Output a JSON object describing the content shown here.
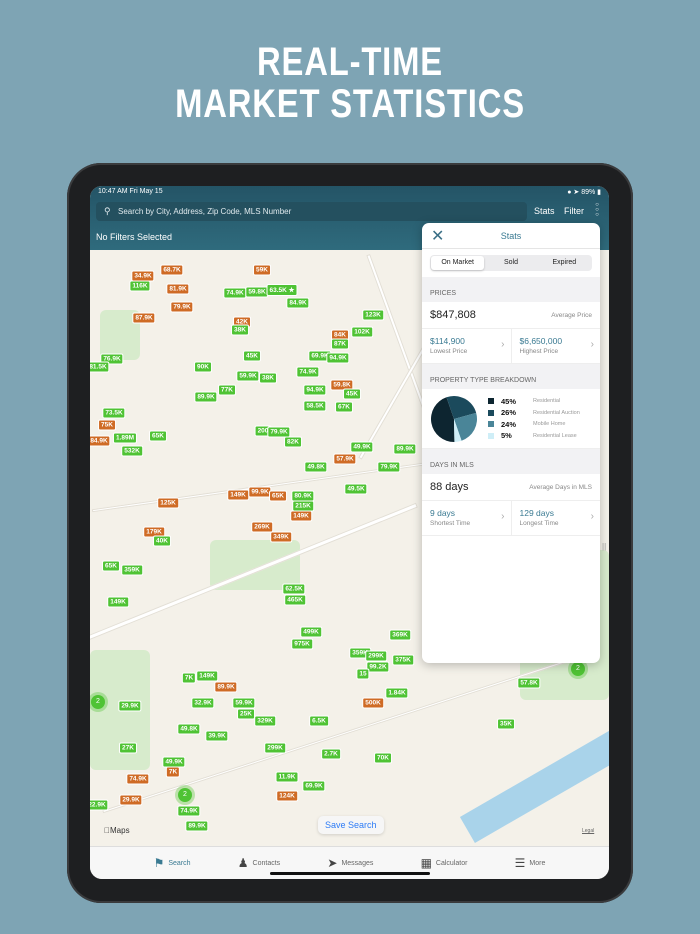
{
  "headline": {
    "line1": "REAL-TIME",
    "line2": "MARKET STATISTICS"
  },
  "status": {
    "time": "10:47 AM  Fri May 15",
    "battery": "89%"
  },
  "header": {
    "search_placeholder": "Search by City, Address, Zip Code, MLS Number",
    "stats_label": "Stats",
    "filter_label": "Filter",
    "filters_text": "No Filters Selected"
  },
  "map": {
    "attribution": "Maps",
    "legal": "Legal",
    "save_search": "Save Search",
    "markers": [
      {
        "p": "68.7K",
        "s": "o"
      },
      {
        "p": "34.9K",
        "s": "o"
      },
      {
        "p": "116K",
        "s": "g"
      },
      {
        "p": "81.9K",
        "s": "o"
      },
      {
        "p": "79.9K",
        "s": "o"
      },
      {
        "p": "87.9K",
        "s": "o"
      },
      {
        "p": "59K",
        "s": "o"
      },
      {
        "p": "74.9K",
        "s": "g"
      },
      {
        "p": "59.8K",
        "s": "g"
      },
      {
        "p": "63.5K ★",
        "s": "g"
      },
      {
        "p": "84.9K",
        "s": "g"
      },
      {
        "p": "42K",
        "s": "o"
      },
      {
        "p": "38K",
        "s": "g"
      },
      {
        "p": "123K",
        "s": "g"
      },
      {
        "p": "102K",
        "s": "g"
      },
      {
        "p": "84K",
        "s": "o"
      },
      {
        "p": "87K",
        "s": "g"
      },
      {
        "p": "45K",
        "s": "g"
      },
      {
        "p": "69.9K",
        "s": "g"
      },
      {
        "p": "94.9K",
        "s": "g"
      },
      {
        "p": "76.9K",
        "s": "g"
      },
      {
        "p": "81.5K",
        "s": "g"
      },
      {
        "p": "90K",
        "s": "g"
      },
      {
        "p": "59.9K",
        "s": "g"
      },
      {
        "p": "38K",
        "s": "g"
      },
      {
        "p": "74.9K",
        "s": "g"
      },
      {
        "p": "59.8K",
        "s": "o"
      },
      {
        "p": "94.9K",
        "s": "g"
      },
      {
        "p": "77K",
        "s": "g"
      },
      {
        "p": "89.9K",
        "s": "g"
      },
      {
        "p": "45K",
        "s": "g"
      },
      {
        "p": "58.5K",
        "s": "g"
      },
      {
        "p": "67K",
        "s": "g"
      },
      {
        "p": "73.5K",
        "s": "g"
      },
      {
        "p": "75K",
        "s": "o"
      },
      {
        "p": "84.9K",
        "s": "o"
      },
      {
        "p": "1.89M",
        "s": "g"
      },
      {
        "p": "65K",
        "s": "g"
      },
      {
        "p": "532K",
        "s": "g"
      },
      {
        "p": "200",
        "s": "g"
      },
      {
        "p": "79.9K",
        "s": "g"
      },
      {
        "p": "82K",
        "s": "g"
      },
      {
        "p": "49.9K",
        "s": "g"
      },
      {
        "p": "89.9K",
        "s": "g"
      },
      {
        "p": "57.9K",
        "s": "o"
      },
      {
        "p": "49.8K",
        "s": "g"
      },
      {
        "p": "79.9K",
        "s": "g"
      },
      {
        "p": "49.5K",
        "s": "g"
      },
      {
        "p": "149K",
        "s": "o"
      },
      {
        "p": "99.9K",
        "s": "o"
      },
      {
        "p": "65K",
        "s": "o"
      },
      {
        "p": "80.9K",
        "s": "g"
      },
      {
        "p": "215K",
        "s": "g"
      },
      {
        "p": "125K",
        "s": "o"
      },
      {
        "p": "149K",
        "s": "o"
      },
      {
        "p": "269K",
        "s": "o"
      },
      {
        "p": "349K",
        "s": "o"
      },
      {
        "p": "179K",
        "s": "o"
      },
      {
        "p": "40K",
        "s": "g"
      },
      {
        "p": "65K",
        "s": "g"
      },
      {
        "p": "359K",
        "s": "g"
      },
      {
        "p": "149K",
        "s": "g"
      },
      {
        "p": "62.5K",
        "s": "g"
      },
      {
        "p": "465K",
        "s": "g"
      },
      {
        "p": "499K",
        "s": "g"
      },
      {
        "p": "975K",
        "s": "g"
      },
      {
        "p": "369K",
        "s": "g"
      },
      {
        "p": "359K",
        "s": "g"
      },
      {
        "p": "299K",
        "s": "g"
      },
      {
        "p": "375K",
        "s": "g"
      },
      {
        "p": "99.2K",
        "s": "g"
      },
      {
        "p": "15",
        "s": "g"
      },
      {
        "p": "7K",
        "s": "g"
      },
      {
        "p": "149K",
        "s": "g"
      },
      {
        "p": "89.9K",
        "s": "o"
      },
      {
        "p": "1.84K",
        "s": "g"
      },
      {
        "p": "500K",
        "s": "o"
      },
      {
        "p": "29.9K",
        "s": "g"
      },
      {
        "p": "32.9K",
        "s": "g"
      },
      {
        "p": "59.9K",
        "s": "g"
      },
      {
        "p": "25K",
        "s": "g"
      },
      {
        "p": "329K",
        "s": "g"
      },
      {
        "p": "6.5K",
        "s": "g"
      },
      {
        "p": "49.8K",
        "s": "g"
      },
      {
        "p": "39.9K",
        "s": "g"
      },
      {
        "p": "299K",
        "s": "g"
      },
      {
        "p": "27K",
        "s": "g"
      },
      {
        "p": "2.7K",
        "s": "g"
      },
      {
        "p": "70K",
        "s": "g"
      },
      {
        "p": "49.9K",
        "s": "g"
      },
      {
        "p": "7K",
        "s": "o"
      },
      {
        "p": "74.9K",
        "s": "o"
      },
      {
        "p": "29.9K",
        "s": "o"
      },
      {
        "p": "11.9K",
        "s": "g"
      },
      {
        "p": "69.9K",
        "s": "g"
      },
      {
        "p": "124K",
        "s": "o"
      },
      {
        "p": "22.9K",
        "s": "g"
      },
      {
        "p": "74.9K",
        "s": "g"
      },
      {
        "p": "89.9K",
        "s": "g"
      },
      {
        "p": "57.8K",
        "s": "g"
      },
      {
        "p": "35K",
        "s": "g"
      }
    ],
    "clusters": [
      "2",
      "2",
      "2"
    ]
  },
  "stats": {
    "title": "Stats",
    "segments": [
      "On Market",
      "Sold",
      "Expired"
    ],
    "prices": {
      "header": "PRICES",
      "average": "$847,808",
      "average_label": "Average Price",
      "lowest": "$114,900",
      "lowest_label": "Lowest Price",
      "highest": "$6,650,000",
      "highest_label": "Highest Price"
    },
    "breakdown": {
      "header": "PROPERTY TYPE BREAKDOWN",
      "items": [
        {
          "pct": "45%",
          "value": 45,
          "label": "Residential",
          "color": "#0d2530"
        },
        {
          "pct": "26%",
          "value": 26,
          "label": "Residential Auction",
          "color": "#1b4a5c"
        },
        {
          "pct": "24%",
          "value": 24,
          "label": "Mobile Home",
          "color": "#4a8598"
        },
        {
          "pct": "5%",
          "value": 5,
          "label": "Residential Lease",
          "color": "#cfeef7"
        }
      ]
    },
    "days": {
      "header": "DAYS IN MLS",
      "average": "88 days",
      "average_label": "Average Days in MLS",
      "shortest": "9 days",
      "shortest_label": "Shortest Time",
      "longest": "129 days",
      "longest_label": "Longest Time"
    }
  },
  "tabs": [
    {
      "label": "Search"
    },
    {
      "label": "Contacts"
    },
    {
      "label": "Messages"
    },
    {
      "label": "Calculator"
    },
    {
      "label": "More"
    }
  ]
}
